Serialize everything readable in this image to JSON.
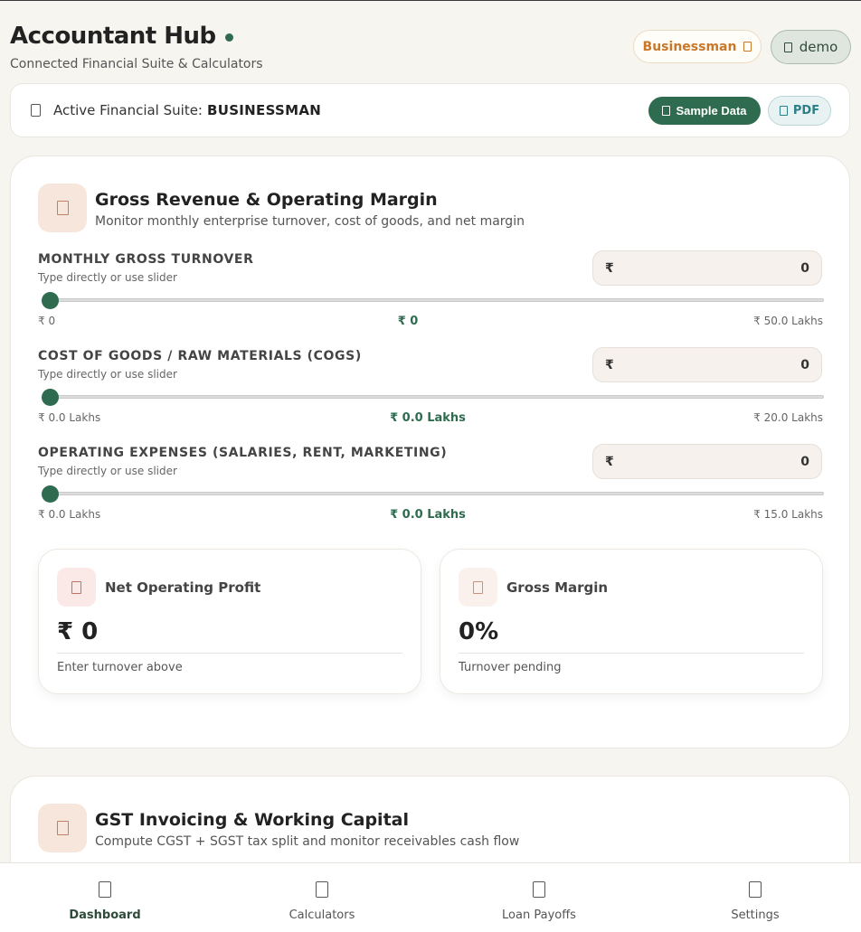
{
  "header": {
    "title": "Accountant Hub",
    "subtitle": "Connected Financial Suite & Calculators",
    "role_badge": "Businessman",
    "user_badge": "demo"
  },
  "suite_bar": {
    "label": "Active Financial Suite:",
    "suite_name": "BUSINESSMAN",
    "sample_button": "Sample Data",
    "pdf_button": "PDF"
  },
  "revenue_card": {
    "title": "Gross Revenue & Operating Margin",
    "description": "Monitor monthly enterprise turnover, cost of goods, and net margin",
    "fields": [
      {
        "label": "MONTHLY GROSS TURNOVER",
        "hint": "Type directly or use slider",
        "currency": "₹",
        "value": "0",
        "range_min": "₹ 0",
        "range_current": "₹ 0",
        "range_max": "₹ 50.0 Lakhs",
        "slider_fraction": 0
      },
      {
        "label": "COST OF GOODS / RAW MATERIALS (COGS)",
        "hint": "Type directly or use slider",
        "currency": "₹",
        "value": "0",
        "range_min": "₹ 0.0 Lakhs",
        "range_current": "₹ 0.0 Lakhs",
        "range_max": "₹ 20.0 Lakhs",
        "slider_fraction": 0
      },
      {
        "label": "OPERATING EXPENSES (SALARIES, RENT, MARKETING)",
        "hint": "Type directly or use slider",
        "currency": "₹",
        "value": "0",
        "range_min": "₹ 0.0 Lakhs",
        "range_current": "₹ 0.0 Lakhs",
        "range_max": "₹ 15.0 Lakhs",
        "slider_fraction": 0
      }
    ],
    "stats": [
      {
        "title": "Net Operating Profit",
        "value": "₹ 0",
        "note": "Enter turnover above"
      },
      {
        "title": "Gross Margin",
        "value": "0%",
        "note": "Turnover pending"
      }
    ]
  },
  "gst_card": {
    "title": "GST Invoicing & Working Capital",
    "description": "Compute CGST + SGST tax split and monitor receivables cash flow"
  },
  "bottom_nav": [
    {
      "label": "Dashboard",
      "active": true
    },
    {
      "label": "Calculators",
      "active": false
    },
    {
      "label": "Loan Payoffs",
      "active": false
    },
    {
      "label": "Settings",
      "active": false
    }
  ],
  "colors": {
    "accent": "#2e6b4f",
    "badge_orange": "#c97728",
    "pdf_teal": "#2b7f86",
    "background": "#f7f5f0"
  }
}
